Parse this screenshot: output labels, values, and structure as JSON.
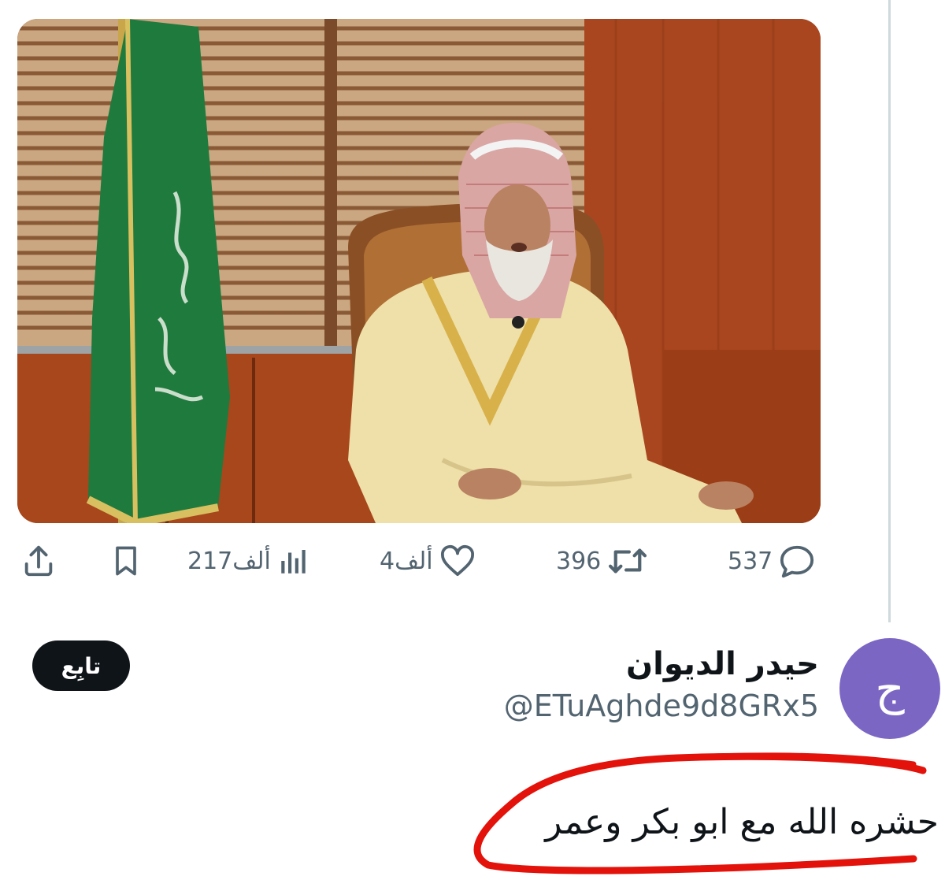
{
  "post": {
    "actions": {
      "replies": "537",
      "reposts": "396",
      "likes": "4ألف",
      "views": "217ألف"
    }
  },
  "reply": {
    "author": {
      "display_name": "حيدر الديوان",
      "handle": "@ETuAghde9d8GRx5",
      "avatar_letter": "ج",
      "avatar_color": "#7b66c4"
    },
    "follow_label": "تابِع",
    "text": "حشره الله مع ابو بكر وعمر"
  },
  "icons": {
    "reply": "reply-icon",
    "repost": "repost-icon",
    "like": "heart-icon",
    "views": "views-icon",
    "bookmark": "bookmark-icon",
    "share": "share-icon"
  },
  "colors": {
    "text_primary": "#0f1419",
    "text_secondary": "#536471",
    "annotation": "#e3120b",
    "flag": "#1f7a3d"
  }
}
